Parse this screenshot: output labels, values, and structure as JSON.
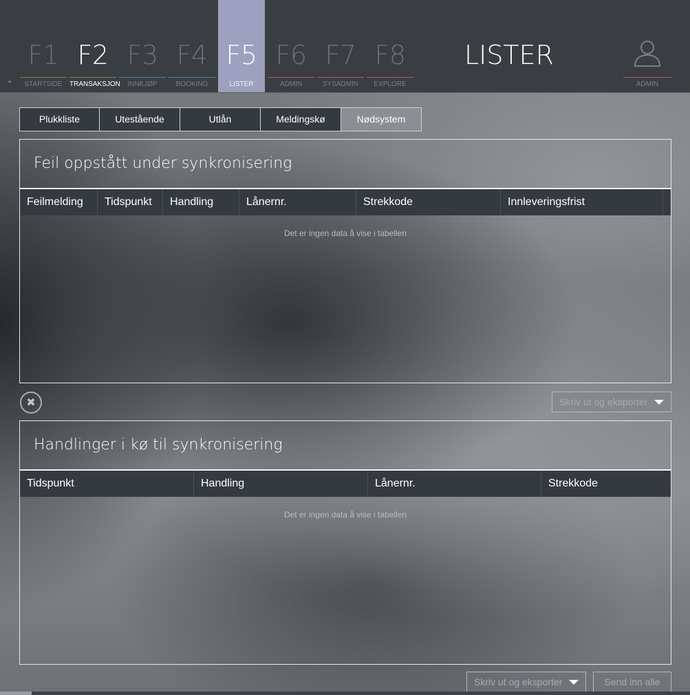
{
  "nav": {
    "fkeys": [
      {
        "key": "F1",
        "label": "STARTSIDE"
      },
      {
        "key": "F2",
        "label": "TRANSAKSJON"
      },
      {
        "key": "F3",
        "label": "INNKJØP"
      },
      {
        "key": "F4",
        "label": "BOOKING"
      },
      {
        "key": "F5",
        "label": "LISTER"
      },
      {
        "key": "F6",
        "label": "ADMIN"
      },
      {
        "key": "F7",
        "label": "SYSADMIN"
      },
      {
        "key": "F8",
        "label": "EXPLORE"
      }
    ],
    "active_key": "F5",
    "collapse_icon": "chevron-up-icon",
    "page_heading": "LISTER",
    "user": {
      "icon": "user-icon",
      "label": "ADMIN"
    },
    "underline_colors": {
      "F1": "#6c8d4a",
      "F2": "#6c8d4a",
      "F3": "#4f7fa4",
      "F4": "#4f7fa4",
      "F6": "#b4565c",
      "F7": "#b4565c",
      "F8": "#b4565c",
      "user": "#b4565c"
    }
  },
  "subtabs": {
    "items": [
      "Plukkliste",
      "Utestående",
      "Utlån",
      "Meldingskø",
      "Nødsystem"
    ],
    "active": "Nødsystem"
  },
  "errors_panel": {
    "title": "Feil oppstått under synkronisering",
    "columns": [
      "Feilmelding",
      "Tidspunkt",
      "Handling",
      "Lånernr.",
      "Strekkode",
      "Innleveringsfrist"
    ],
    "empty_message": "Det er ingen data å vise i tabellen",
    "clear_icon": "close-circle-icon",
    "export_label": "Skriv ut og eksporter"
  },
  "queue_panel": {
    "title": "Handlinger i kø til synkronisering",
    "columns": [
      "Tidspunkt",
      "Handling",
      "Lånernr.",
      "Strekkode"
    ],
    "empty_message": "Det er ingen data å vise i tabellen",
    "export_label": "Skriv ut og eksporter",
    "send_label": "Send inn alle"
  }
}
